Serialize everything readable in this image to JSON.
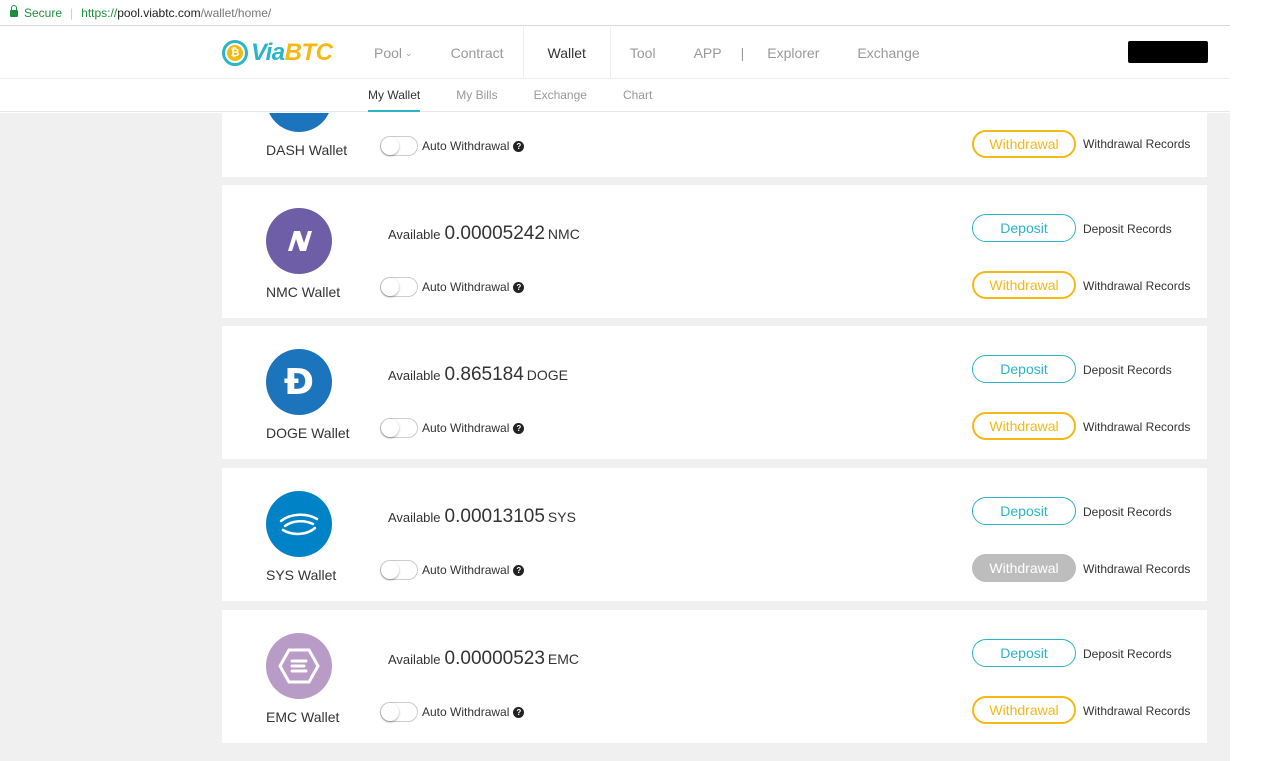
{
  "browser": {
    "secure_label": "Secure",
    "url_scheme": "https://",
    "url_host": "pool.viabtc.com",
    "url_path": "/wallet/home/"
  },
  "logo": {
    "part1": "Via",
    "part2": "BTC",
    "mark": "₿"
  },
  "nav": {
    "pool": "Pool",
    "contract": "Contract",
    "wallet": "Wallet",
    "tool": "Tool",
    "app": "APP",
    "divider": "|",
    "explorer": "Explorer",
    "exchange": "Exchange"
  },
  "subnav": {
    "my_wallet": "My Wallet",
    "my_bills": "My Bills",
    "exchange": "Exchange",
    "chart": "Chart"
  },
  "common": {
    "available": "Available",
    "auto_withdrawal": "Auto Withdrawal",
    "deposit": "Deposit",
    "deposit_records": "Deposit Records",
    "withdrawal": "Withdrawal",
    "withdrawal_records": "Withdrawal Records",
    "help": "?"
  },
  "wallets": [
    {
      "name": "DASH Wallet",
      "color": "#1c75bc"
    },
    {
      "name": "NMC Wallet",
      "amount": "0.00005242",
      "unit": "NMC",
      "color": "#6e5ea8",
      "glyph": "N"
    },
    {
      "name": "DOGE Wallet",
      "amount": "0.865184",
      "unit": "DOGE",
      "color": "#1c75bc",
      "glyph": "Đ"
    },
    {
      "name": "SYS Wallet",
      "amount": "0.00013105",
      "unit": "SYS",
      "color": "#0082c6",
      "glyph": "≈"
    },
    {
      "name": "EMC Wallet",
      "amount": "0.00000523",
      "unit": "EMC",
      "color": "#b89bc6",
      "glyph": "⬡"
    }
  ],
  "colors": {
    "accent": "#2bb5c9",
    "gold": "#f5b914",
    "disabled": "#bdbdbd"
  }
}
